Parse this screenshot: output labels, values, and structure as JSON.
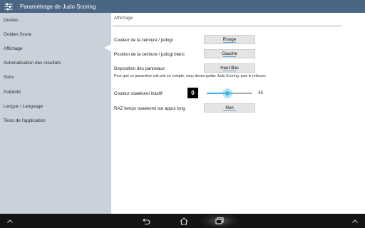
{
  "action_bar": {
    "title": "Paramétrage de Judo Scoring",
    "icon": "settings-sliders-icon"
  },
  "left_nav": {
    "items": [
      {
        "label": "Durées"
      },
      {
        "label": "Golden Score"
      },
      {
        "label": "Affichage"
      },
      {
        "label": "Automatisation des résultats"
      },
      {
        "label": "Sons"
      },
      {
        "label": "Publicité"
      },
      {
        "label": "Langue / Language"
      },
      {
        "label": "Tests de l'application"
      }
    ],
    "active_index": 2
  },
  "content": {
    "section_title": "Affichage",
    "belt_color": {
      "label": "Couleur de la ceinture / judogi",
      "value": "Rouge"
    },
    "belt_position": {
      "label": "Position de la ceinture / judogi blanc",
      "value": "Gauche"
    },
    "panel_layout": {
      "label": "Disposition des panneaux",
      "value": "Haut-Bas"
    },
    "restart_note": "Pour que ce paramètre soit pris en compte, vous devez quitter Judo Scoring, puis le relancer.",
    "osaekomi_color": {
      "label": "Couleur osaekomi inactif",
      "swatch_text": "0",
      "slider_value": "45",
      "slider_fraction": 0.45
    },
    "reset_osaekomi": {
      "label": "RAZ temps osaekomi sur appui long",
      "value": "Non"
    }
  },
  "colors": {
    "action_bar": "#4b6584",
    "left_panel": "#c9d2db",
    "accent": "#33b5e5",
    "nav_bar": "#141414"
  },
  "nav_bar": {
    "icons": [
      "chevron-up-left-icon",
      "back-icon",
      "home-icon",
      "recent-apps-icon",
      "chevron-up-right-icon"
    ]
  }
}
